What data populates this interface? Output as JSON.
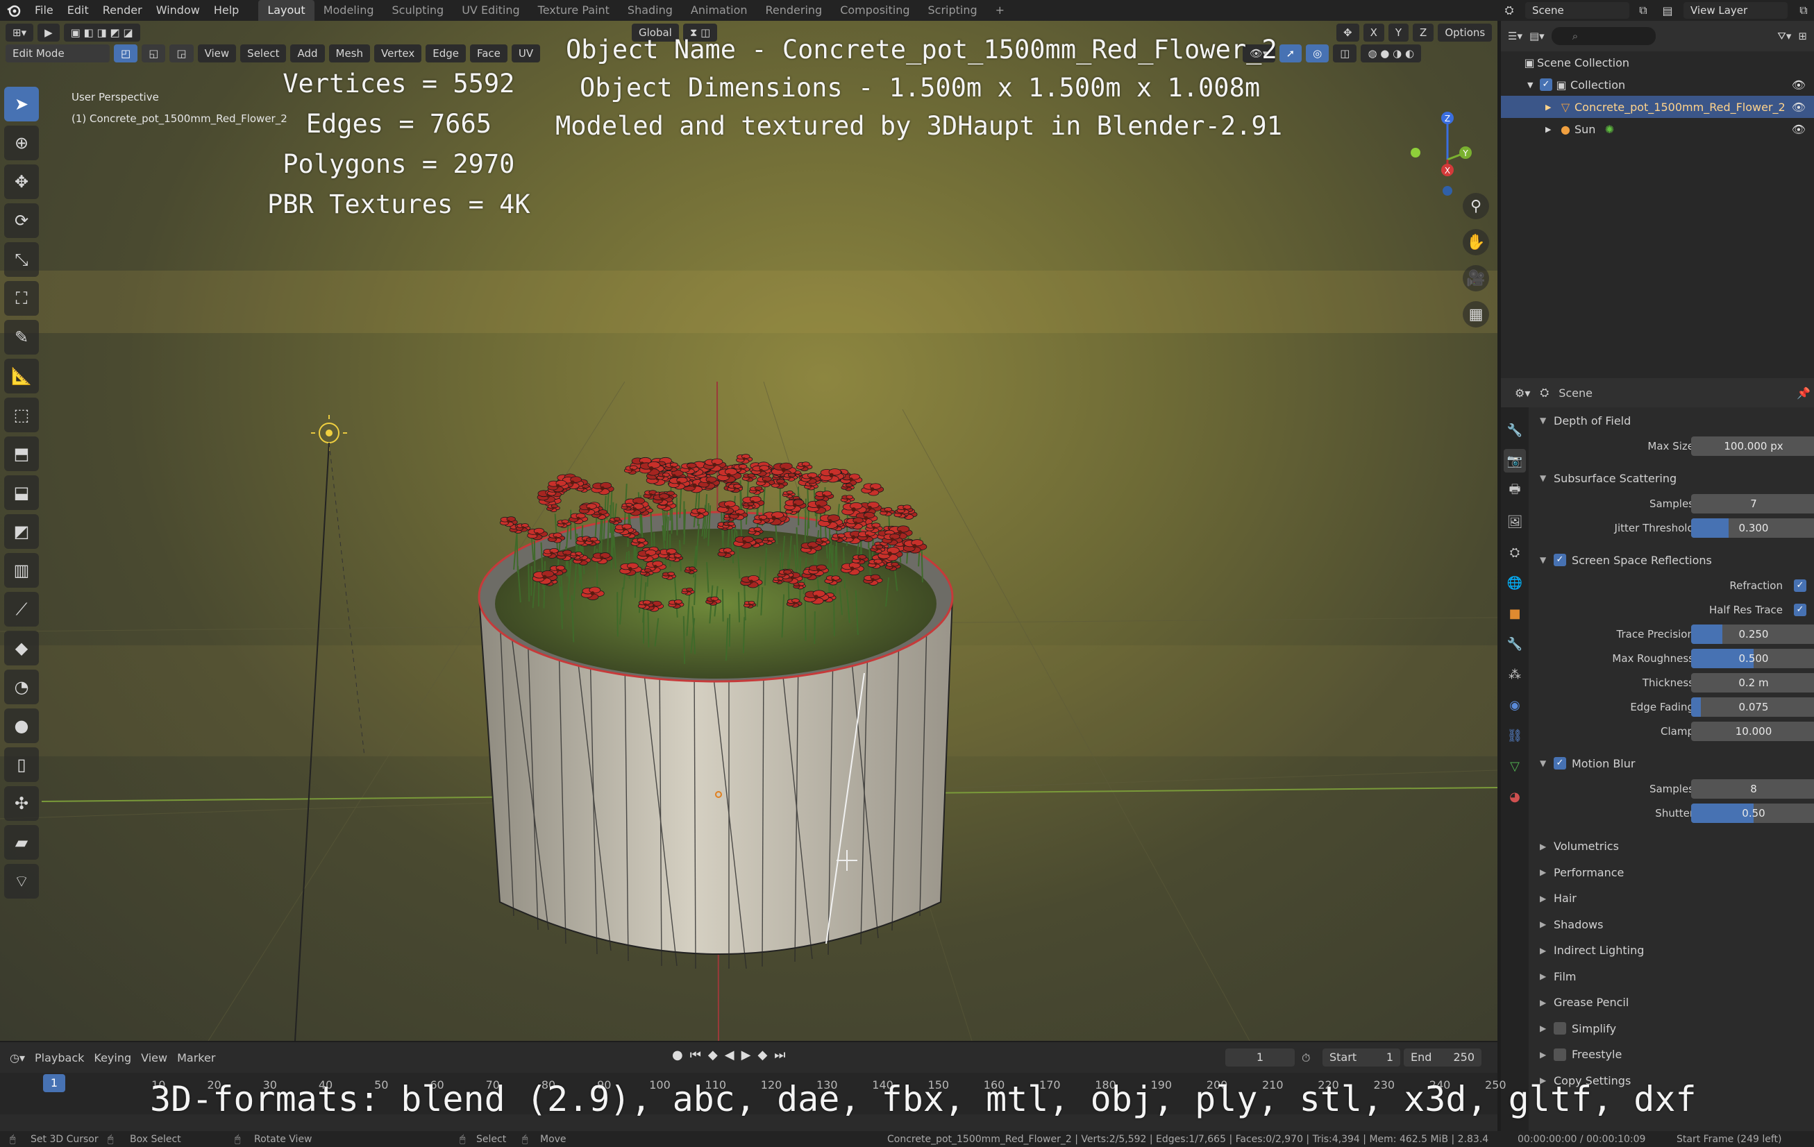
{
  "menu": [
    "File",
    "Edit",
    "Render",
    "Window",
    "Help"
  ],
  "workspaces": [
    "Layout",
    "Modeling",
    "Sculpting",
    "UV Editing",
    "Texture Paint",
    "Shading",
    "Animation",
    "Rendering",
    "Compositing",
    "Scripting",
    "+"
  ],
  "active_workspace": "Layout",
  "scene_name": "Scene",
  "view_layer": "View Layer",
  "viewport": {
    "mode": "Edit Mode",
    "header_menus": [
      "View",
      "Select",
      "Add",
      "Mesh",
      "Vertex",
      "Edge",
      "Face",
      "UV"
    ],
    "orientation": "Global",
    "options_label": "Options",
    "axis_toggles": [
      "X",
      "Y",
      "Z"
    ],
    "view_label": "User Perspective",
    "object_label": "(1) Concrete_pot_1500mm_Red_Flower_2"
  },
  "overlay": {
    "stats": [
      "Vertices = 5592",
      "Edges = 7665",
      "Polygons = 2970",
      "PBR Textures = 4K"
    ],
    "object_info": [
      "Object Name - Concrete_pot_1500mm_Red_Flower_2",
      "Object Dimensions -  1.500m x 1.500m x 1.008m",
      "Modeled and textured by 3DHaupt in Blender-2.91"
    ],
    "formats": "3D-formats: blend (2.9), abc, dae, fbx, mtl, obj, ply, stl, x3d, gltf, dxf"
  },
  "outliner": {
    "root": "Scene Collection",
    "items": [
      {
        "label": "Collection"
      },
      {
        "label": "Concrete_pot_1500mm_Red_Flower_2"
      },
      {
        "label": "Sun"
      }
    ]
  },
  "properties": {
    "header": "Scene",
    "sections": {
      "dof": "Depth of Field",
      "sss": "Subsurface Scattering",
      "ssr": "Screen Space Reflections",
      "motion_blur": "Motion Blur"
    },
    "dof_max_size": {
      "label": "Max Size",
      "value": "100.000 px"
    },
    "sss_samples": {
      "label": "Samples",
      "value": "7"
    },
    "sss_jitter": {
      "label": "Jitter Threshold",
      "value": "0.300",
      "fraction": 0.3
    },
    "ssr_refraction": {
      "label": "Refraction",
      "checked": true
    },
    "ssr_half_res": {
      "label": "Half Res Trace",
      "checked": true
    },
    "ssr_trace_precision": {
      "label": "Trace Precision",
      "value": "0.250",
      "fraction": 0.25
    },
    "ssr_max_roughness": {
      "label": "Max Roughness",
      "value": "0.500",
      "fraction": 0.5
    },
    "ssr_thickness": {
      "label": "Thickness",
      "value": "0.2 m"
    },
    "ssr_edge_fading": {
      "label": "Edge Fading",
      "value": "0.075",
      "fraction": 0.075
    },
    "ssr_clamp": {
      "label": "Clamp",
      "value": "10.000"
    },
    "mb_samples": {
      "label": "Samples",
      "value": "8"
    },
    "mb_shutter": {
      "label": "Shutter",
      "value": "0.50",
      "fraction": 0.5
    },
    "collapsed": [
      "Volumetrics",
      "Performance",
      "Hair",
      "Shadows",
      "Indirect Lighting",
      "Film",
      "Grease Pencil",
      "Simplify",
      "Freestyle",
      "Copy Settings"
    ]
  },
  "timeline": {
    "menus": [
      "Playback",
      "Keying",
      "View",
      "Marker"
    ],
    "current_frame": "1",
    "start_label": "Start",
    "start": "1",
    "end_label": "End",
    "end": "250",
    "ticks": [
      "10",
      "20",
      "30",
      "40",
      "50",
      "60",
      "70",
      "80",
      "90",
      "100",
      "110",
      "120",
      "130",
      "140",
      "150",
      "160",
      "170",
      "180",
      "190",
      "200",
      "210",
      "220",
      "230",
      "240",
      "250"
    ]
  },
  "statusbar": {
    "hints": [
      "Set 3D Cursor",
      "Box Select",
      "Rotate View",
      "Select",
      "Move"
    ],
    "stats": "Concrete_pot_1500mm_Red_Flower_2 | Verts:2/5,592 | Edges:1/7,665 | Faces:0/2,970 | Tris:4,394 | Mem: 462.5 MiB | 2.83.4",
    "time": "00:00:00:00 / 00:00:10:09",
    "start_frame": "Start Frame (249 left)"
  },
  "colors": {
    "accent": "#4772b3",
    "selected_text": "#ffd38b",
    "flower": "#c8302a",
    "pot": "#c9c4b4"
  }
}
